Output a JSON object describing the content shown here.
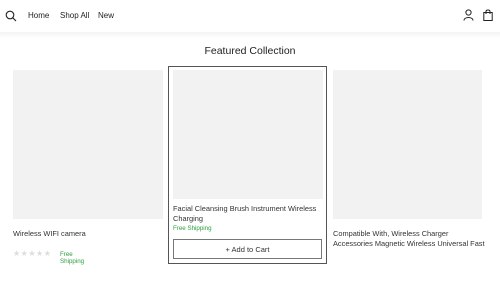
{
  "header": {
    "nav": [
      {
        "label": "Home"
      },
      {
        "label": "Shop All"
      },
      {
        "label": "New"
      }
    ],
    "icons": {
      "search": "search-icon",
      "account": "user-icon",
      "cart": "bag-icon"
    }
  },
  "section": {
    "title": "Featured Collection"
  },
  "products": [
    {
      "name": "Wireless WIFI camera",
      "shipping": "Free Shipping",
      "rating_stars": "★★★★★",
      "rating": 0
    },
    {
      "name": "Facial Cleansing Brush Instrument Wireless Charging",
      "shipping": "Free Shipping",
      "button": "+ Add to Cart"
    },
    {
      "name": "Compatible With, Wireless Charger Accessories Magnetic Wireless Universal Fast"
    }
  ],
  "colors": {
    "shipping": "#2e9d3e",
    "image_placeholder": "#f2f2f2"
  }
}
